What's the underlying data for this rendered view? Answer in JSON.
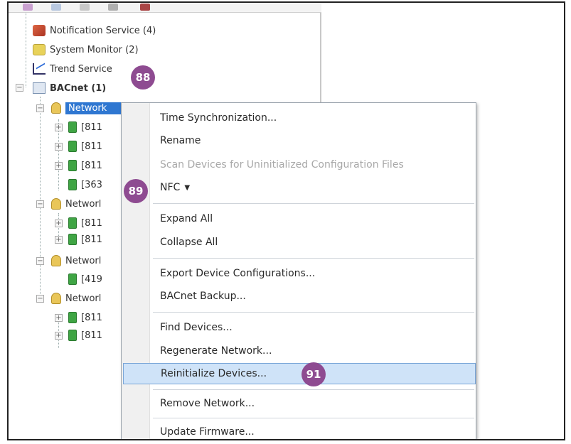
{
  "tree": {
    "items": [
      {
        "label": "Notification Service (4)"
      },
      {
        "label": "System Monitor (2)"
      },
      {
        "label": "Trend Service"
      },
      {
        "label": "BACnet (1)"
      },
      {
        "label": "Network"
      },
      {
        "label": "[811"
      },
      {
        "label": "[811"
      },
      {
        "label": "[811"
      },
      {
        "label": "[363"
      },
      {
        "label": "Networl"
      },
      {
        "label": "[811"
      },
      {
        "label": "[811"
      },
      {
        "label": "Networl"
      },
      {
        "label": "[419"
      },
      {
        "label": "Networl"
      },
      {
        "label": "[811"
      },
      {
        "label": "[811"
      }
    ]
  },
  "context_menu": {
    "items": [
      {
        "label": "Time Synchronization..."
      },
      {
        "label": "Rename"
      },
      {
        "label": "Scan Devices for Uninitialized Configuration Files"
      },
      {
        "label": "NFC"
      },
      {
        "label": "Expand All"
      },
      {
        "label": "Collapse All"
      },
      {
        "label": "Export Device Configurations..."
      },
      {
        "label": "BACnet Backup..."
      },
      {
        "label": "Find Devices..."
      },
      {
        "label": "Regenerate Network..."
      },
      {
        "label": "Reinitialize Devices..."
      },
      {
        "label": "Remove Network..."
      },
      {
        "label": "Update Firmware..."
      }
    ]
  },
  "callouts": {
    "c88": "88",
    "c89": "89",
    "c91": "91"
  },
  "colors": {
    "callout": "#8e4b91",
    "selection": "#2f77d1",
    "menu_highlight": "#cfe3f8"
  }
}
